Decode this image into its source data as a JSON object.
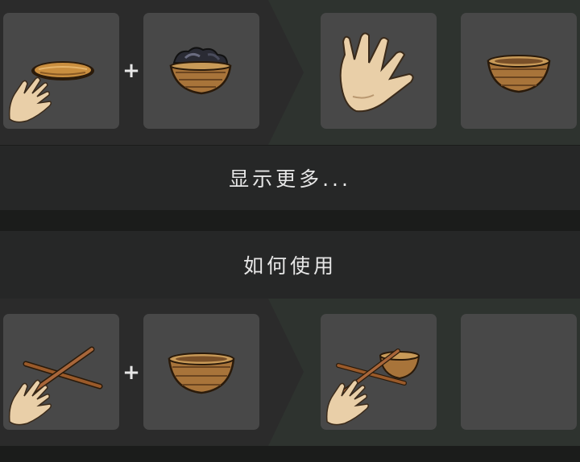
{
  "recipes": [
    {
      "ingredients": [
        {
          "item": "straw-mat",
          "action": "hand-tap"
        },
        {
          "item": "basket-with-dark-items",
          "action": ""
        }
      ],
      "plus_symbol": "+",
      "results": [
        {
          "item": "hand",
          "action": ""
        },
        {
          "item": "basket",
          "action": ""
        }
      ]
    },
    {
      "ingredients": [
        {
          "item": "crossed-sticks",
          "action": "hand-tap"
        },
        {
          "item": "basket",
          "action": ""
        }
      ],
      "plus_symbol": "+",
      "results": [
        {
          "item": "sticks-and-basket",
          "action": "hand-tap"
        },
        {
          "item": "empty",
          "action": ""
        }
      ]
    }
  ],
  "show_more_label": "显示更多...",
  "how_to_use_label": "如何使用",
  "colors": {
    "background": "#1b1c1b",
    "row_background": "#2b2b2b",
    "result_background": "#2e332f",
    "slot": "#484848",
    "bar": "#262727",
    "text": "#e6e6e6"
  }
}
